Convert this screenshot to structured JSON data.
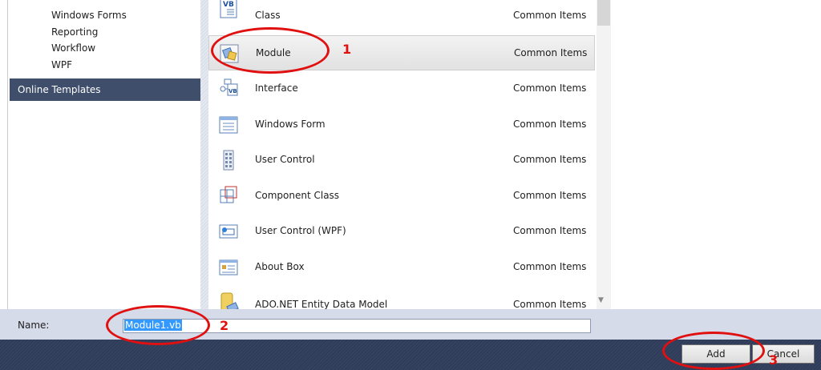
{
  "tree": {
    "items": [
      "Windows Forms",
      "Reporting",
      "Workflow",
      "WPF"
    ],
    "online_templates": "Online Templates"
  },
  "templates": [
    {
      "name": "Class",
      "category": "Common Items",
      "icon": "vb-class-icon"
    },
    {
      "name": "Module",
      "category": "Common Items",
      "icon": "vb-module-icon",
      "selected": true
    },
    {
      "name": "Interface",
      "category": "Common Items",
      "icon": "vb-interface-icon"
    },
    {
      "name": "Windows Form",
      "category": "Common Items",
      "icon": "windows-form-icon"
    },
    {
      "name": "User Control",
      "category": "Common Items",
      "icon": "user-control-icon"
    },
    {
      "name": "Component Class",
      "category": "Common Items",
      "icon": "component-class-icon"
    },
    {
      "name": "User Control (WPF)",
      "category": "Common Items",
      "icon": "wpf-user-control-icon"
    },
    {
      "name": "About Box",
      "category": "Common Items",
      "icon": "about-box-icon"
    },
    {
      "name": "ADO.NET Entity Data Model",
      "category": "Common Items",
      "icon": "entity-data-model-icon"
    }
  ],
  "name_field": {
    "label": "Name:",
    "value": "Module1.vb"
  },
  "buttons": {
    "add": "Add",
    "cancel": "Cancel"
  },
  "annotations": [
    "1",
    "2",
    "3"
  ],
  "colors": {
    "annotation": "#e01010",
    "selection": "#3399ff",
    "online_templates_bg": "#3f4f6b"
  }
}
